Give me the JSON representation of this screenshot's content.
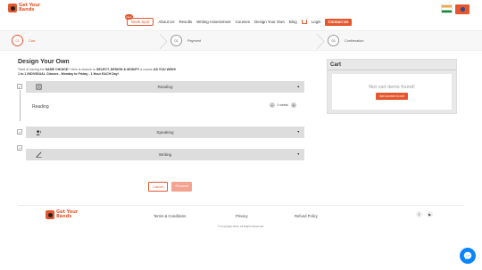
{
  "brand": {
    "line1": "Get Your",
    "line2": "Bands"
  },
  "nav": {
    "work_badge": "New",
    "work_label": "Work Spot",
    "about": "About Us",
    "results": "Results",
    "writing": "Writing Assessment",
    "courses": "Courses",
    "design": "Design Your Own",
    "blog": "Blog",
    "login": "Login",
    "contact": "Contact Us"
  },
  "steps": [
    {
      "num": "01",
      "label": "Cart"
    },
    {
      "num": "02",
      "label": "Payment"
    },
    {
      "num": "03",
      "label": "Confirmation"
    }
  ],
  "main": {
    "title": "Design Your Own",
    "intro_pre": "Tired of having the ",
    "intro_b1": "SAME CHOICE",
    "intro_mid": "? Here is chance to ",
    "intro_b2": "SELECT, DESIGN & MODIFY",
    "intro_mid2": " a course ",
    "intro_b3": "AS YOU WISH!",
    "intro_line2": "1 to 1 INDIVIDUAL Classes - Monday to Friday - 1 Hour EACH Day!"
  },
  "courses": [
    {
      "name": "Reading",
      "body_name": "Reading",
      "weeks": "0 weeks",
      "icon": "book-icon"
    },
    {
      "name": "Speaking",
      "icon": "speaking-icon"
    },
    {
      "name": "Writing",
      "icon": "pen-icon"
    }
  ],
  "actions": {
    "cancel": "Cancel",
    "proceed": "Proceed"
  },
  "cart": {
    "title": "Cart",
    "empty": "Not cart items found!",
    "add": "Add courses to cart"
  },
  "footer": {
    "terms": "Terms & Conditions",
    "privacy": "Privacy",
    "refund": "Refund Policy",
    "facebook": "f",
    "youtube": "▶",
    "copyright": "© Copyright 2021, All Rights Reserved."
  },
  "colors": {
    "accent": "#e4572e",
    "messenger": "#0b84ff"
  }
}
